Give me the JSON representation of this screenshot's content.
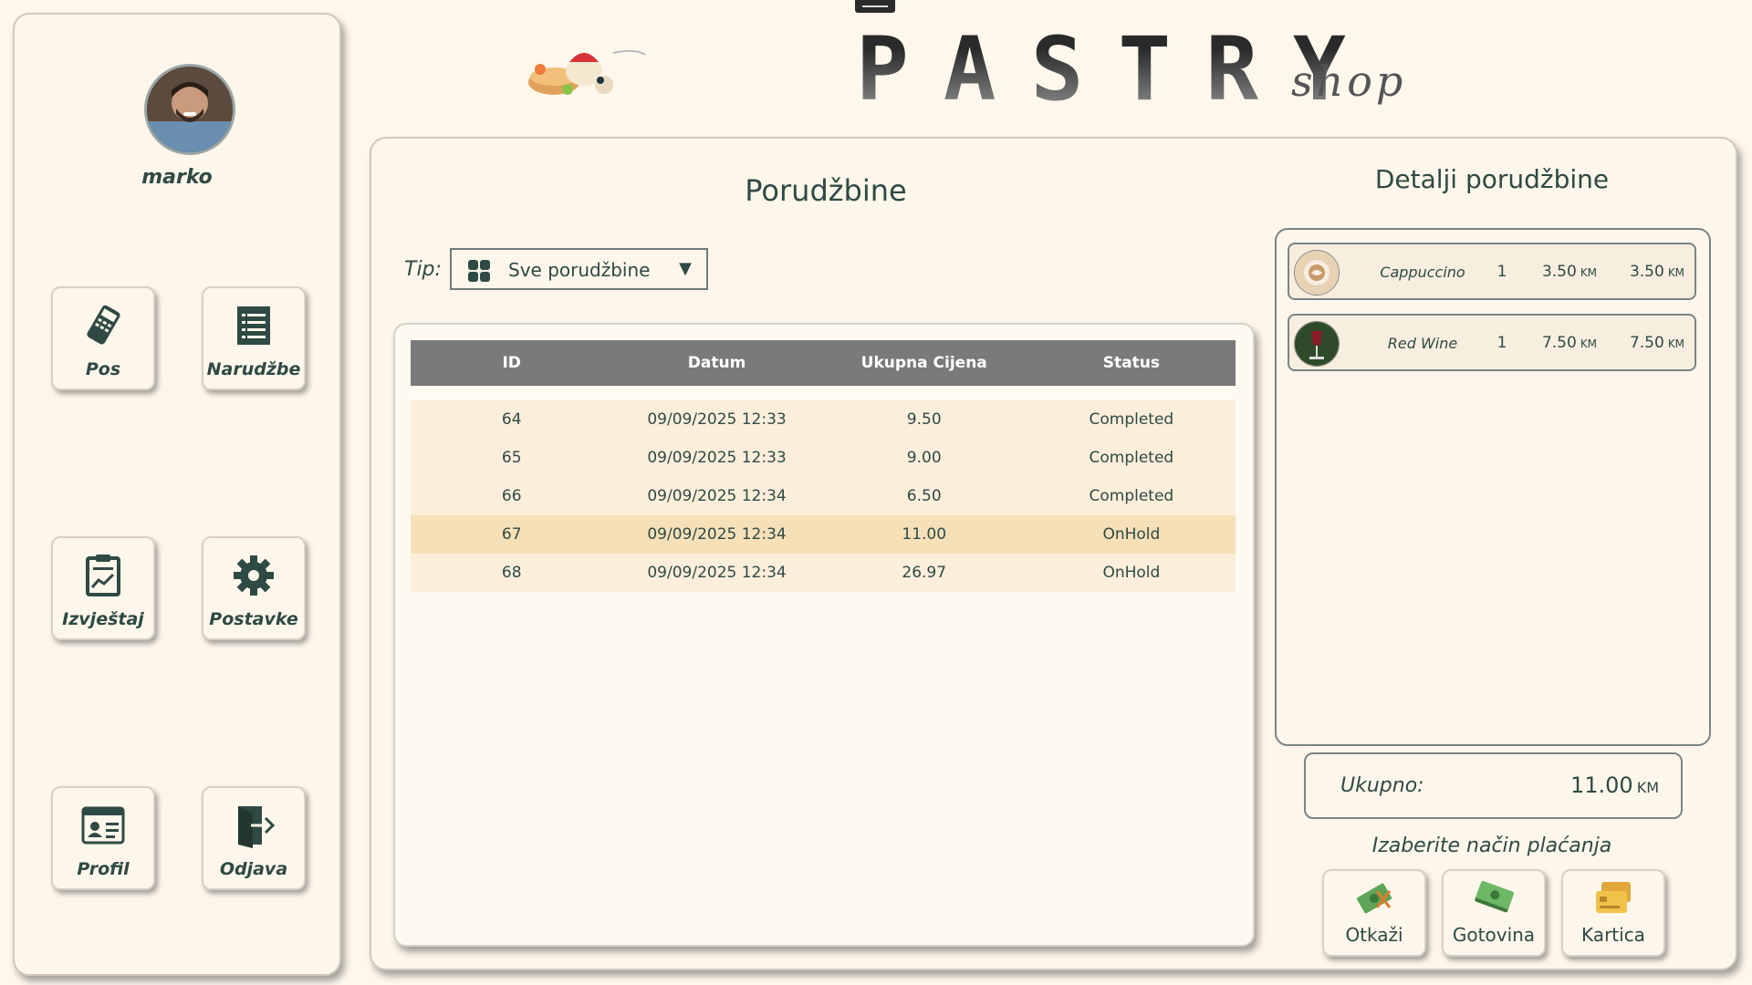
{
  "user": {
    "name": "marko"
  },
  "nav": {
    "pos": "Pos",
    "orders": "Narudžbe",
    "report": "Izvještaj",
    "settings": "Postavke",
    "profile": "Profil",
    "logout": "Odjava"
  },
  "brand": {
    "title": "PASTRY",
    "subtitle": "shop"
  },
  "orders": {
    "title": "Porudžbine",
    "filter_label": "Tip:",
    "filter_value": "Sve porudžbine",
    "columns": [
      "ID",
      "Datum",
      "Ukupna Cijena",
      "Status"
    ],
    "rows": [
      {
        "id": "64",
        "date": "09/09/2025 12:33",
        "total": "9.50",
        "status": "Completed"
      },
      {
        "id": "65",
        "date": "09/09/2025 12:33",
        "total": "9.00",
        "status": "Completed"
      },
      {
        "id": "66",
        "date": "09/09/2025 12:34",
        "total": "6.50",
        "status": "Completed"
      },
      {
        "id": "67",
        "date": "09/09/2025 12:34",
        "total": "11.00",
        "status": "OnHold"
      },
      {
        "id": "68",
        "date": "09/09/2025 12:34",
        "total": "26.97",
        "status": "OnHold"
      }
    ],
    "selected_id": "67"
  },
  "details": {
    "title": "Detalji porudžbine",
    "items": [
      {
        "name": "Cappuccino",
        "qty": "1",
        "price": "3.50",
        "total": "3.50",
        "currency": "KM"
      },
      {
        "name": "Red Wine",
        "qty": "1",
        "price": "7.50",
        "total": "7.50",
        "currency": "KM"
      }
    ],
    "total_label": "Ukupno:",
    "total_value": "11.00",
    "currency": "KM"
  },
  "payment": {
    "title": "Izaberite način plaćanja",
    "cancel": "Otkaži",
    "cash": "Gotovina",
    "card": "Kartica"
  },
  "colors": {
    "background": "#fdf7ec",
    "accent": "#2f4a44",
    "table_header": "#7a7a7a",
    "row": "#fbeedb",
    "row_selected": "#f6e0b8"
  }
}
